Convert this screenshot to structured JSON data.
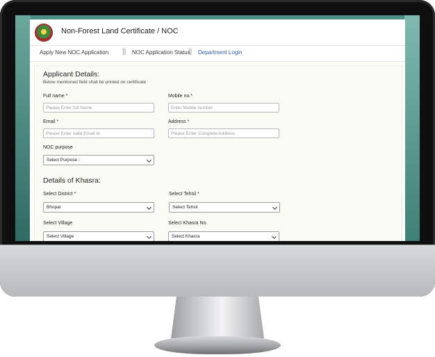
{
  "header": {
    "title": "Non-Forest Land Certificate / NOC",
    "logo_icon": "emblem-logo-icon"
  },
  "nav": {
    "items": [
      "Apply New NOC Application",
      "NOC Application Status",
      "Department Login"
    ],
    "separator": "||"
  },
  "applicant": {
    "heading": "Applicant Details:",
    "subheading": "Below mentioned field shall be printed on certificate",
    "full_name": {
      "label": "Full name *",
      "placeholder": "Please Enter full Name"
    },
    "mobile": {
      "label": "Mobile no.*",
      "placeholder": "Enter Mobile number"
    },
    "email": {
      "label": "Email *",
      "placeholder": "Please Enter valid Email Id"
    },
    "address": {
      "label": "Address *",
      "placeholder": "Please Enter Complete Address"
    },
    "purpose": {
      "label": "NOC purpose",
      "selected": "Select Purpose -"
    }
  },
  "khasra": {
    "heading": "Details of Khasra:",
    "district": {
      "label": "Select District *",
      "selected": "Bhopal"
    },
    "tehsil": {
      "label": "Select Tehsil *",
      "selected": "Select Tehsil"
    },
    "village": {
      "label": "Select Village",
      "selected": "Select Village"
    },
    "khasra_no": {
      "label": "Select Khasra No.",
      "selected": "Select Khasra"
    }
  },
  "colors": {
    "link": "#2e5fa8",
    "screen_bg": "#4d8e86",
    "page_bg": "#fdfdf9"
  }
}
